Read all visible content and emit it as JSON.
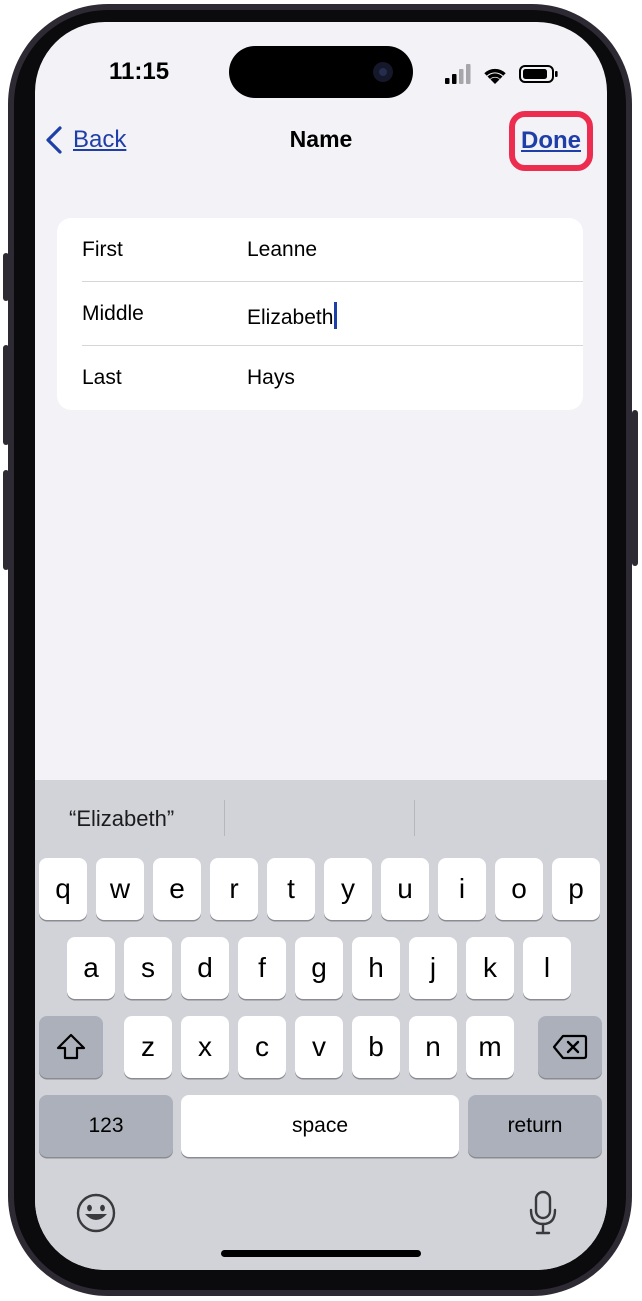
{
  "status_bar": {
    "time": "11:15"
  },
  "nav": {
    "back_label": "Back",
    "title": "Name",
    "done_label": "Done"
  },
  "fields": [
    {
      "label": "First",
      "value": "Leanne"
    },
    {
      "label": "Middle",
      "value": "Elizabeth"
    },
    {
      "label": "Last",
      "value": "Hays"
    }
  ],
  "keyboard": {
    "suggestion": "“Elizabeth”",
    "row1": [
      "q",
      "w",
      "e",
      "r",
      "t",
      "y",
      "u",
      "i",
      "o",
      "p"
    ],
    "row2": [
      "a",
      "s",
      "d",
      "f",
      "g",
      "h",
      "j",
      "k",
      "l"
    ],
    "row3": [
      "z",
      "x",
      "c",
      "v",
      "b",
      "n",
      "m"
    ],
    "numbers_label": "123",
    "space_label": "space",
    "return_label": "return"
  },
  "colors": {
    "accent": "#1f3fa8",
    "highlight": "#ec2d50",
    "background": "#f2f2f7",
    "keyboard": "#d1d3d9"
  }
}
